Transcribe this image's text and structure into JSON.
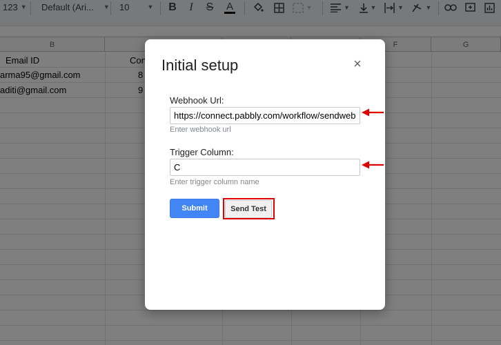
{
  "toolbar": {
    "number_format": "123",
    "font_name": "Default (Ari...",
    "font_size": "10",
    "icons": [
      "bold-icon",
      "italic-icon",
      "strikethrough-icon",
      "text-color-icon",
      "fill-color-icon",
      "borders-icon",
      "merge-cells-icon",
      "align-icon",
      "valign-icon",
      "text-wrap-icon",
      "text-rotate-icon",
      "link-icon",
      "comment-icon",
      "chart-icon"
    ]
  },
  "sheet": {
    "columns": [
      "B",
      "F",
      "G"
    ],
    "header_row": {
      "email": "Email ID",
      "contact_partial": "Con"
    },
    "rows": [
      {
        "email": "arma95@gmail.com",
        "contact_partial": "8"
      },
      {
        "email": "aditi@gmail.com",
        "contact_partial": "9"
      }
    ]
  },
  "dialog": {
    "title": "Initial setup",
    "close": "×",
    "webhook_label": "Webhook Url:",
    "webhook_value": "https://connect.pabbly.com/workflow/sendwebh",
    "webhook_hint": "Enter webhook url",
    "trigger_label": "Trigger Column:",
    "trigger_value": "C",
    "trigger_hint": "Enter trigger column name",
    "submit_label": "Submit",
    "test_label": "Send Test"
  },
  "colors": {
    "submit_blue": "#4285f4",
    "annotation_red": "#e00000"
  }
}
